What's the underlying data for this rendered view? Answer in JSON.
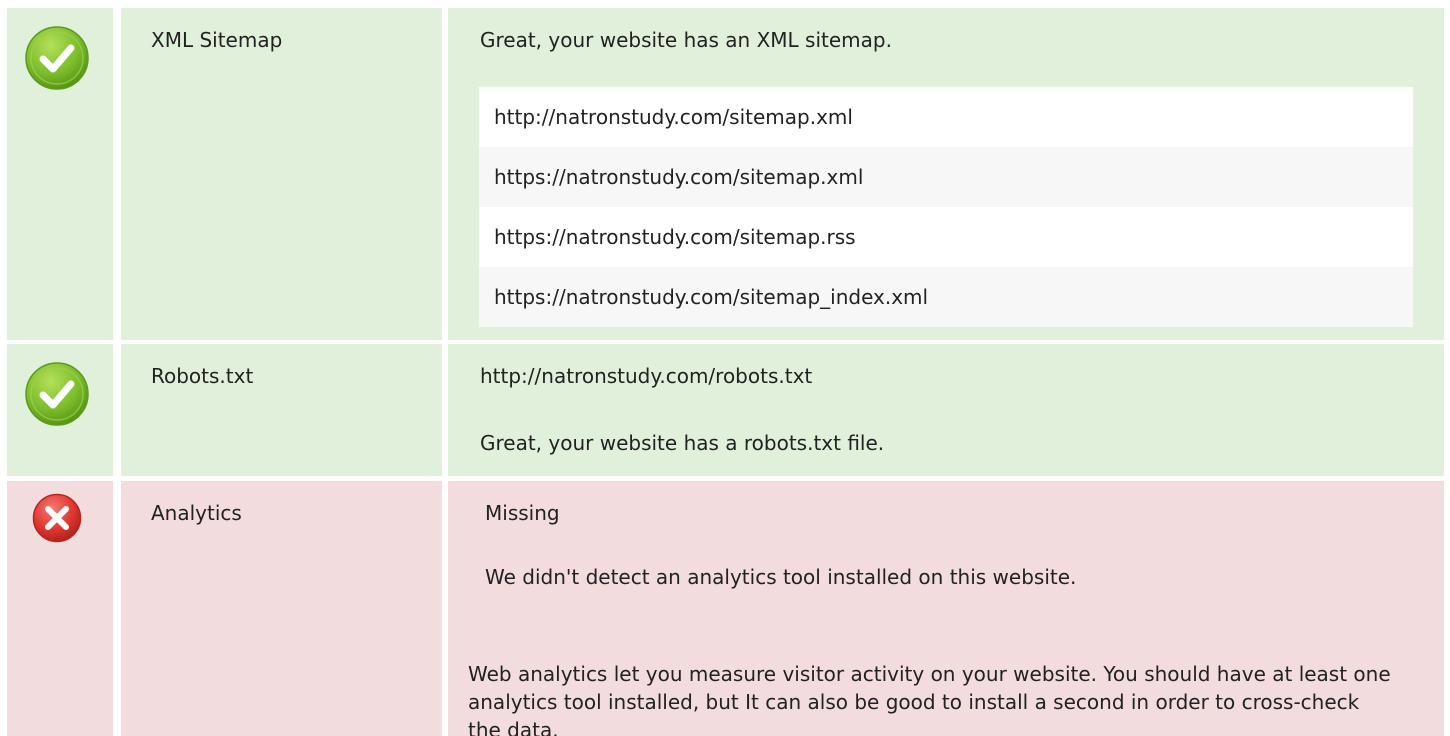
{
  "sitemap": {
    "status": "pass",
    "status_icon": "check-circle-icon",
    "label": "XML Sitemap",
    "message": "Great, your website has an XML sitemap.",
    "urls": [
      "http://natronstudy.com/sitemap.xml",
      "https://natronstudy.com/sitemap.xml",
      "https://natronstudy.com/sitemap.rss",
      "https://natronstudy.com/sitemap_index.xml"
    ]
  },
  "robots": {
    "status": "pass",
    "status_icon": "check-circle-icon",
    "label": "Robots.txt",
    "url": "http://natronstudy.com/robots.txt",
    "message": "Great, your website has a robots.txt file."
  },
  "analytics": {
    "status": "fail",
    "status_icon": "x-circle-icon",
    "label": "Analytics",
    "state": "Missing",
    "message": "We didn't detect an analytics tool installed on this website.",
    "explanation": "Web analytics let you measure visitor activity on your website. You should have at least one analytics tool installed, but It can also be good to install a second in order to cross-check the data."
  },
  "colors": {
    "pass_background": "#e1f0db",
    "fail_background": "#f2dcdd",
    "pass_icon": "#7cbd2c",
    "fail_icon": "#e0362f"
  }
}
